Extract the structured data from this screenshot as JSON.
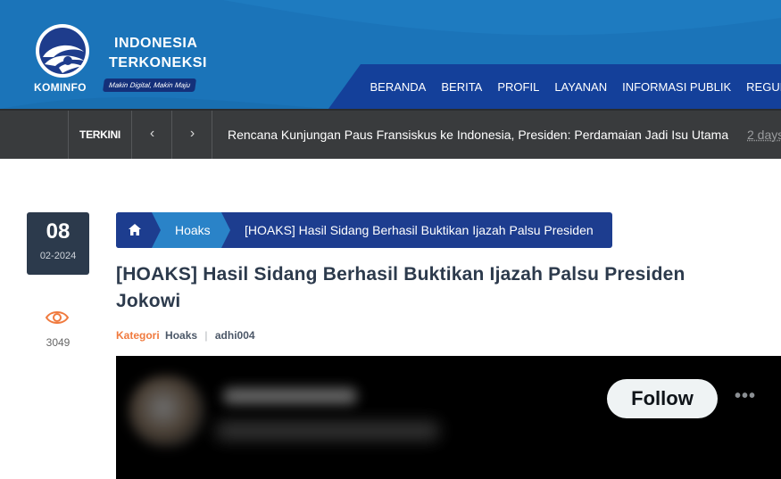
{
  "header": {
    "logo_name": "KOMINFO",
    "brand_line1": "INDONESIA",
    "brand_line2": "TERKONEKSI",
    "brand_tagline": "Makin Digital, Makin Maju",
    "nav": [
      "BERANDA",
      "BERITA",
      "PROFIL",
      "LAYANAN",
      "INFORMASI PUBLIK",
      "REGULASI"
    ],
    "colors": {
      "header_bg": "#1b74b9",
      "nav_bg": "#14409a"
    }
  },
  "ticker": {
    "label": "TERKINI",
    "prev_icon": "chevron-left-icon",
    "next_icon": "chevron-right-icon",
    "prev_glyph": "‹",
    "next_glyph": "›",
    "headline": "Rencana Kunjungan Paus Fransiskus ke Indonesia, Presiden: Perdamaian Jadi Isu Utama",
    "time": "2 days"
  },
  "post": {
    "day": "08",
    "month_year": "02-2024",
    "views": "3049",
    "breadcrumb": {
      "home_icon": "home-icon",
      "category": "Hoaks",
      "current": "[HOAKS] Hasil Sidang Berhasil Buktikan Ijazah Palsu Presiden"
    },
    "title": "[HOAKS] Hasil Sidang Berhasil Buktikan Ijazah Palsu Presiden Jokowi",
    "meta": {
      "category_label": "Kategori",
      "category": "Hoaks",
      "separator": "|",
      "author": "adhi004"
    },
    "embed": {
      "follow_label": "Follow",
      "more_glyph": "•••"
    }
  }
}
